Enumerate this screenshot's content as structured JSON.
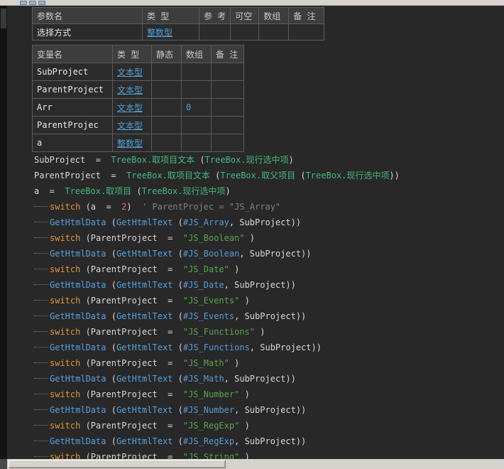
{
  "window": {
    "toolbar_icons": [
      "mini-toolbar-icon",
      "mini-toolbar-icon",
      "mini-toolbar-icon"
    ]
  },
  "colors": {
    "editor_bg": "#282828",
    "keyword": "#e0963c",
    "function": "#56a2dc",
    "constant": "#569cd6",
    "string": "#57a64a",
    "method": "#43b97f",
    "number": "#d16d9e",
    "comment": "#7f7f7f",
    "type_link": "#4f9fd6"
  },
  "param_table": {
    "headers": [
      "参数名",
      "类 型",
      "参 考",
      "可空",
      "数组",
      "备 注"
    ],
    "rows": [
      {
        "name": "选择方式",
        "type": "整数型",
        "ref": "",
        "nullable": "",
        "array": "",
        "remark": ""
      }
    ]
  },
  "var_table": {
    "headers": [
      "变量名",
      "类 型",
      "静态",
      "数组",
      "备 注"
    ],
    "rows": [
      {
        "name": "SubProject",
        "type": "文本型",
        "static": "",
        "array": "",
        "remark": ""
      },
      {
        "name": "ParentProject",
        "type": "文本型",
        "static": "",
        "array": "",
        "remark": ""
      },
      {
        "name": "Arr",
        "type": "文本型",
        "static": "",
        "array": "0",
        "remark": ""
      },
      {
        "name": "ParentProjec",
        "type": "文本型",
        "static": "",
        "array": "",
        "remark": ""
      },
      {
        "name": "a",
        "type": "整数型",
        "static": "",
        "array": "",
        "remark": ""
      }
    ]
  },
  "code": {
    "lines": [
      {
        "guide": false,
        "tokens": [
          {
            "t": "SubProject  =  ",
            "c": "plain"
          },
          {
            "t": "TreeBox.取项目文本",
            "c": "method"
          },
          {
            "t": " (",
            "c": "plain"
          },
          {
            "t": "TreeBox.现行选中项",
            "c": "method"
          },
          {
            "t": ")",
            "c": "plain"
          }
        ]
      },
      {
        "guide": false,
        "tokens": [
          {
            "t": "ParentProject  =  ",
            "c": "plain"
          },
          {
            "t": "TreeBox.取项目文本",
            "c": "method"
          },
          {
            "t": " (",
            "c": "plain"
          },
          {
            "t": "TreeBox.取父项目",
            "c": "method"
          },
          {
            "t": " (",
            "c": "plain"
          },
          {
            "t": "TreeBox.现行选中项",
            "c": "method"
          },
          {
            "t": "))",
            "c": "plain"
          }
        ]
      },
      {
        "guide": false,
        "tokens": [
          {
            "t": "a  =  ",
            "c": "plain"
          },
          {
            "t": "TreeBox.取项目",
            "c": "method"
          },
          {
            "t": " (",
            "c": "plain"
          },
          {
            "t": "TreeBox.现行选中项",
            "c": "method"
          },
          {
            "t": ")",
            "c": "plain"
          }
        ]
      },
      {
        "guide": true,
        "tokens": [
          {
            "t": "switch",
            "c": "kw"
          },
          {
            "t": " (a  =  ",
            "c": "plain"
          },
          {
            "t": "2",
            "c": "num"
          },
          {
            "t": ")",
            "c": "plain"
          },
          {
            "t": "  ' ParentProjec = \"JS_Array\"",
            "c": "comment"
          }
        ]
      },
      {
        "guide": true,
        "tokens": [
          {
            "t": "GetHtmlData",
            "c": "func"
          },
          {
            "t": " (",
            "c": "plain"
          },
          {
            "t": "GetHtmlText",
            "c": "func"
          },
          {
            "t": " (",
            "c": "plain"
          },
          {
            "t": "#JS_Array",
            "c": "const"
          },
          {
            "t": ", SubProject))",
            "c": "plain"
          }
        ]
      },
      {
        "guide": true,
        "tokens": [
          {
            "t": "switch",
            "c": "kw"
          },
          {
            "t": " (ParentProject  =  ",
            "c": "plain"
          },
          {
            "t": "\"JS_Boolean\"",
            "c": "str"
          },
          {
            "t": " )",
            "c": "plain"
          }
        ]
      },
      {
        "guide": true,
        "tokens": [
          {
            "t": "GetHtmlData",
            "c": "func"
          },
          {
            "t": " (",
            "c": "plain"
          },
          {
            "t": "GetHtmlText",
            "c": "func"
          },
          {
            "t": " (",
            "c": "plain"
          },
          {
            "t": "#JS_Boolean",
            "c": "const"
          },
          {
            "t": ", SubProject))",
            "c": "plain"
          }
        ]
      },
      {
        "guide": true,
        "tokens": [
          {
            "t": "switch",
            "c": "kw"
          },
          {
            "t": " (ParentProject  =  ",
            "c": "plain"
          },
          {
            "t": "\"JS_Date\"",
            "c": "str"
          },
          {
            "t": " )",
            "c": "plain"
          }
        ]
      },
      {
        "guide": true,
        "tokens": [
          {
            "t": "GetHtmlData",
            "c": "func"
          },
          {
            "t": " (",
            "c": "plain"
          },
          {
            "t": "GetHtmlText",
            "c": "func"
          },
          {
            "t": " (",
            "c": "plain"
          },
          {
            "t": "#JS_Date",
            "c": "const"
          },
          {
            "t": ", SubProject))",
            "c": "plain"
          }
        ]
      },
      {
        "guide": true,
        "tokens": [
          {
            "t": "switch",
            "c": "kw"
          },
          {
            "t": " (ParentProject  =  ",
            "c": "plain"
          },
          {
            "t": "\"JS_Events\"",
            "c": "str"
          },
          {
            "t": " )",
            "c": "plain"
          }
        ]
      },
      {
        "guide": true,
        "tokens": [
          {
            "t": "GetHtmlData",
            "c": "func"
          },
          {
            "t": " (",
            "c": "plain"
          },
          {
            "t": "GetHtmlText",
            "c": "func"
          },
          {
            "t": " (",
            "c": "plain"
          },
          {
            "t": "#JS_Events",
            "c": "const"
          },
          {
            "t": ", SubProject))",
            "c": "plain"
          }
        ]
      },
      {
        "guide": true,
        "tokens": [
          {
            "t": "switch",
            "c": "kw"
          },
          {
            "t": " (ParentProject  =  ",
            "c": "plain"
          },
          {
            "t": "\"JS_Functions\"",
            "c": "str"
          },
          {
            "t": " )",
            "c": "plain"
          }
        ]
      },
      {
        "guide": true,
        "tokens": [
          {
            "t": "GetHtmlData",
            "c": "func"
          },
          {
            "t": " (",
            "c": "plain"
          },
          {
            "t": "GetHtmlText",
            "c": "func"
          },
          {
            "t": " (",
            "c": "plain"
          },
          {
            "t": "#JS_Functions",
            "c": "const"
          },
          {
            "t": ", SubProject))",
            "c": "plain"
          }
        ]
      },
      {
        "guide": true,
        "tokens": [
          {
            "t": "switch",
            "c": "kw"
          },
          {
            "t": " (ParentProject  =  ",
            "c": "plain"
          },
          {
            "t": "\"JS_Math\"",
            "c": "str"
          },
          {
            "t": " )",
            "c": "plain"
          }
        ]
      },
      {
        "guide": true,
        "tokens": [
          {
            "t": "GetHtmlData",
            "c": "func"
          },
          {
            "t": " (",
            "c": "plain"
          },
          {
            "t": "GetHtmlText",
            "c": "func"
          },
          {
            "t": " (",
            "c": "plain"
          },
          {
            "t": "#JS_Math",
            "c": "const"
          },
          {
            "t": ", SubProject))",
            "c": "plain"
          }
        ]
      },
      {
        "guide": true,
        "tokens": [
          {
            "t": "switch",
            "c": "kw"
          },
          {
            "t": " (ParentProject  =  ",
            "c": "plain"
          },
          {
            "t": "\"JS_Number\"",
            "c": "str"
          },
          {
            "t": " )",
            "c": "plain"
          }
        ]
      },
      {
        "guide": true,
        "tokens": [
          {
            "t": "GetHtmlData",
            "c": "func"
          },
          {
            "t": " (",
            "c": "plain"
          },
          {
            "t": "GetHtmlText",
            "c": "func"
          },
          {
            "t": " (",
            "c": "plain"
          },
          {
            "t": "#JS_Number",
            "c": "const"
          },
          {
            "t": ", SubProject))",
            "c": "plain"
          }
        ]
      },
      {
        "guide": true,
        "tokens": [
          {
            "t": "switch",
            "c": "kw"
          },
          {
            "t": " (ParentProject  =  ",
            "c": "plain"
          },
          {
            "t": "\"JS_RegExp\"",
            "c": "str"
          },
          {
            "t": " )",
            "c": "plain"
          }
        ]
      },
      {
        "guide": true,
        "tokens": [
          {
            "t": "GetHtmlData",
            "c": "func"
          },
          {
            "t": " (",
            "c": "plain"
          },
          {
            "t": "GetHtmlText",
            "c": "func"
          },
          {
            "t": " (",
            "c": "plain"
          },
          {
            "t": "#JS_RegExp",
            "c": "const"
          },
          {
            "t": ", SubProject))",
            "c": "plain"
          }
        ]
      },
      {
        "guide": true,
        "tokens": [
          {
            "t": "switch",
            "c": "kw"
          },
          {
            "t": " (ParentProject  =  ",
            "c": "plain"
          },
          {
            "t": "\"JS_String\"",
            "c": "str"
          },
          {
            "t": " )",
            "c": "plain"
          }
        ]
      }
    ]
  }
}
